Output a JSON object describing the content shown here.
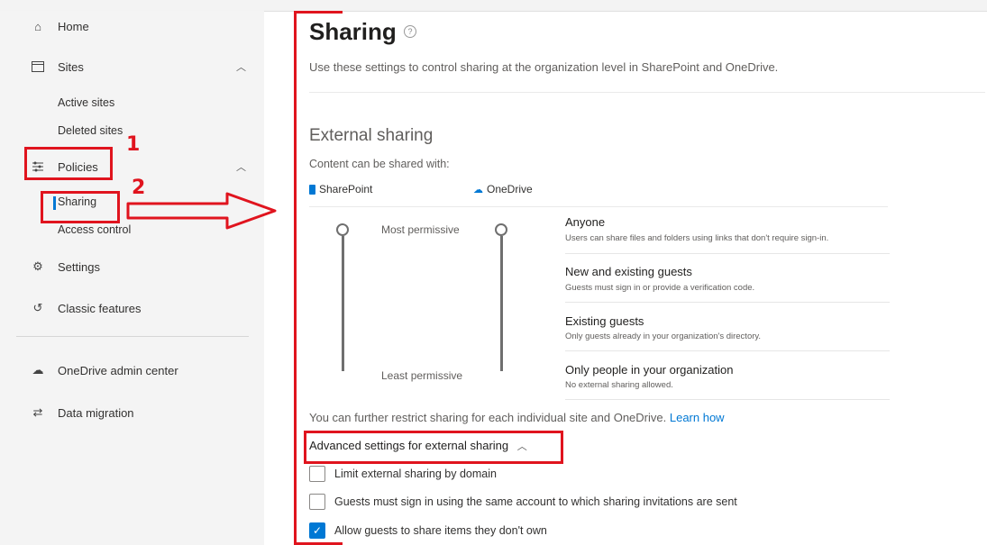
{
  "sidebar": {
    "home": "Home",
    "sites": "Sites",
    "active_sites": "Active sites",
    "deleted_sites": "Deleted sites",
    "policies": "Policies",
    "sharing": "Sharing",
    "access_control": "Access control",
    "settings": "Settings",
    "classic_features": "Classic features",
    "onedrive_admin": "OneDrive admin center",
    "data_migration": "Data migration"
  },
  "main": {
    "title": "Sharing",
    "description": "Use these settings to control sharing at the organization level in SharePoint and OneDrive.",
    "external_sharing": "External sharing",
    "content_shared_with": "Content can be shared with:",
    "sharepoint": "SharePoint",
    "onedrive": "OneDrive",
    "most_permissive": "Most permissive",
    "least_permissive": "Least permissive",
    "levels": [
      {
        "title": "Anyone",
        "desc": "Users can share files and folders using links that don't require sign-in."
      },
      {
        "title": "New and existing guests",
        "desc": "Guests must sign in or provide a verification code."
      },
      {
        "title": "Existing guests",
        "desc": "Only guests already in your organization's directory."
      },
      {
        "title": "Only people in your organization",
        "desc": "No external sharing allowed."
      }
    ],
    "restrict_text": "You can further restrict sharing for each individual site and OneDrive.",
    "learn_how": "Learn how",
    "advanced_settings": "Advanced settings for external sharing",
    "checkboxes": [
      {
        "label": "Limit external sharing by domain",
        "checked": false
      },
      {
        "label": "Guests must sign in using the same account to which sharing invitations are sent",
        "checked": false
      },
      {
        "label": "Allow guests to share items they don't own",
        "checked": true
      }
    ]
  },
  "annotations": {
    "color": "#e0141e",
    "mark_1": "1",
    "mark_2": "2"
  }
}
